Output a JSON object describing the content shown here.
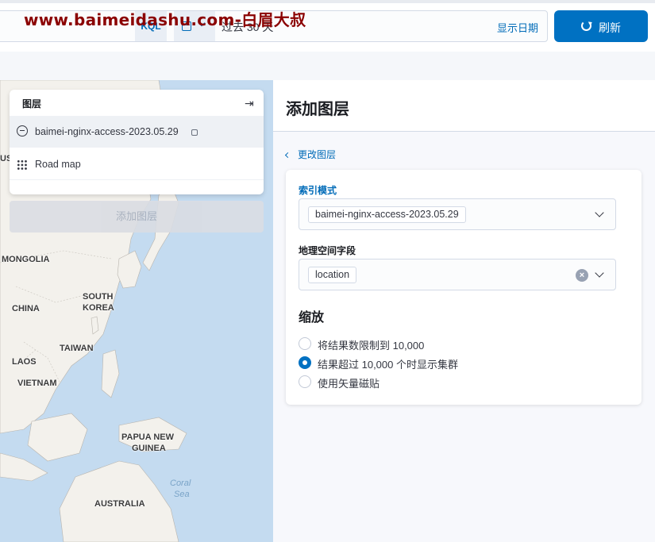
{
  "watermark": "www.baimeidashu.com-白眉大叔",
  "query_bar": {
    "kql_label": "KQL",
    "date_range": "过去 30 天",
    "show_dates_label": "显示日期",
    "refresh_label": "刷新"
  },
  "map": {
    "labels": {
      "russia_fragment": "USS",
      "mongolia": "MONGOLIA",
      "china": "CHINA",
      "south_korea_1": "SOUTH",
      "south_korea_2": "KOREA",
      "taiwan": "TAIWAN",
      "laos": "LAOS",
      "vietnam": "VIETNAM",
      "png_1": "PAPUA NEW",
      "png_2": "GUINEA",
      "coral_1": "Coral",
      "coral_2": "Sea",
      "australia": "AUSTRALIA"
    }
  },
  "layers_panel": {
    "title": "图层",
    "layers": [
      {
        "label": "baimei-nginx-access-2023.05.29",
        "icon": "minus-circle-icon"
      },
      {
        "label": "Road map",
        "icon": "grid-icon"
      }
    ],
    "add_layer_label": "添加图层"
  },
  "flyout": {
    "title": "添加图层",
    "change_layer_label": "更改图层",
    "index_pattern": {
      "label": "索引模式",
      "value": "baimei-nginx-access-2023.05.29"
    },
    "geo_field": {
      "label": "地理空间字段",
      "value": "location"
    },
    "scaling": {
      "title": "缩放",
      "options": [
        {
          "label": "将结果数限制到 10,000",
          "checked": false
        },
        {
          "label": "结果超过 10,000 个时显示集群",
          "checked": true
        },
        {
          "label": "使用矢量磁贴",
          "checked": false
        }
      ]
    }
  },
  "colors": {
    "accent": "#0071c2",
    "link": "#006bb8",
    "watermark": "#8b0000"
  }
}
